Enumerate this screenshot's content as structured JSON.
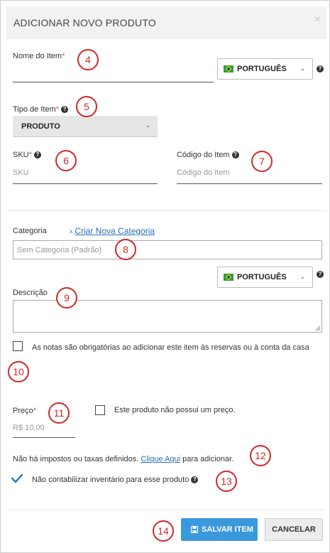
{
  "modal": {
    "title": "ADICIONAR NOVO PRODUTO",
    "close_glyph": "×"
  },
  "item_name": {
    "label": "Nome do Item",
    "required_mark": "*",
    "value": ""
  },
  "language_select_1": {
    "value": "PORTUGUÊS",
    "flag_icon": "brazil-flag-icon"
  },
  "item_type": {
    "label": "Tipo de Item",
    "required_mark": "*",
    "value": "PRODUTO"
  },
  "sku": {
    "label": "SKU",
    "required_mark": "*",
    "placeholder": "SKU"
  },
  "item_code": {
    "label": "Código do Item",
    "placeholder": "Código do Item"
  },
  "category": {
    "label": "Categoria",
    "create_link_prefix": "›",
    "create_link": "Criar Nova Categoria",
    "placeholder": "Sem Categoria (Padrão)"
  },
  "language_select_2": {
    "value": "PORTUGUÊS",
    "flag_icon": "brazil-flag-icon"
  },
  "description": {
    "label": "Descrição",
    "value": ""
  },
  "notes_required": {
    "label": "As notas são obrigatórias ao adicionar este item às reservas ou à conta da casa",
    "checked": false
  },
  "price": {
    "label": "Preço",
    "required_mark": "*",
    "placeholder": "R$ 10,00"
  },
  "no_price": {
    "label": "Este produto não possui um preço.",
    "checked": false
  },
  "taxes": {
    "text_before": "Não há impostos ou taxas definidos.",
    "link": "Clique Aqui",
    "text_after": "para adicionar."
  },
  "inventory": {
    "label": "Não contabilizar inventário para esse produto",
    "checked": true
  },
  "buttons": {
    "save": "SALVAR ITEM",
    "cancel": "CANCELAR"
  },
  "callouts": [
    "4",
    "5",
    "6",
    "7",
    "8",
    "9",
    "10",
    "11",
    "12",
    "13",
    "14"
  ],
  "colors": {
    "primary": "#3a98dc",
    "callout": "#d02828",
    "link": "#2a6db7",
    "required": "#d9534f"
  }
}
